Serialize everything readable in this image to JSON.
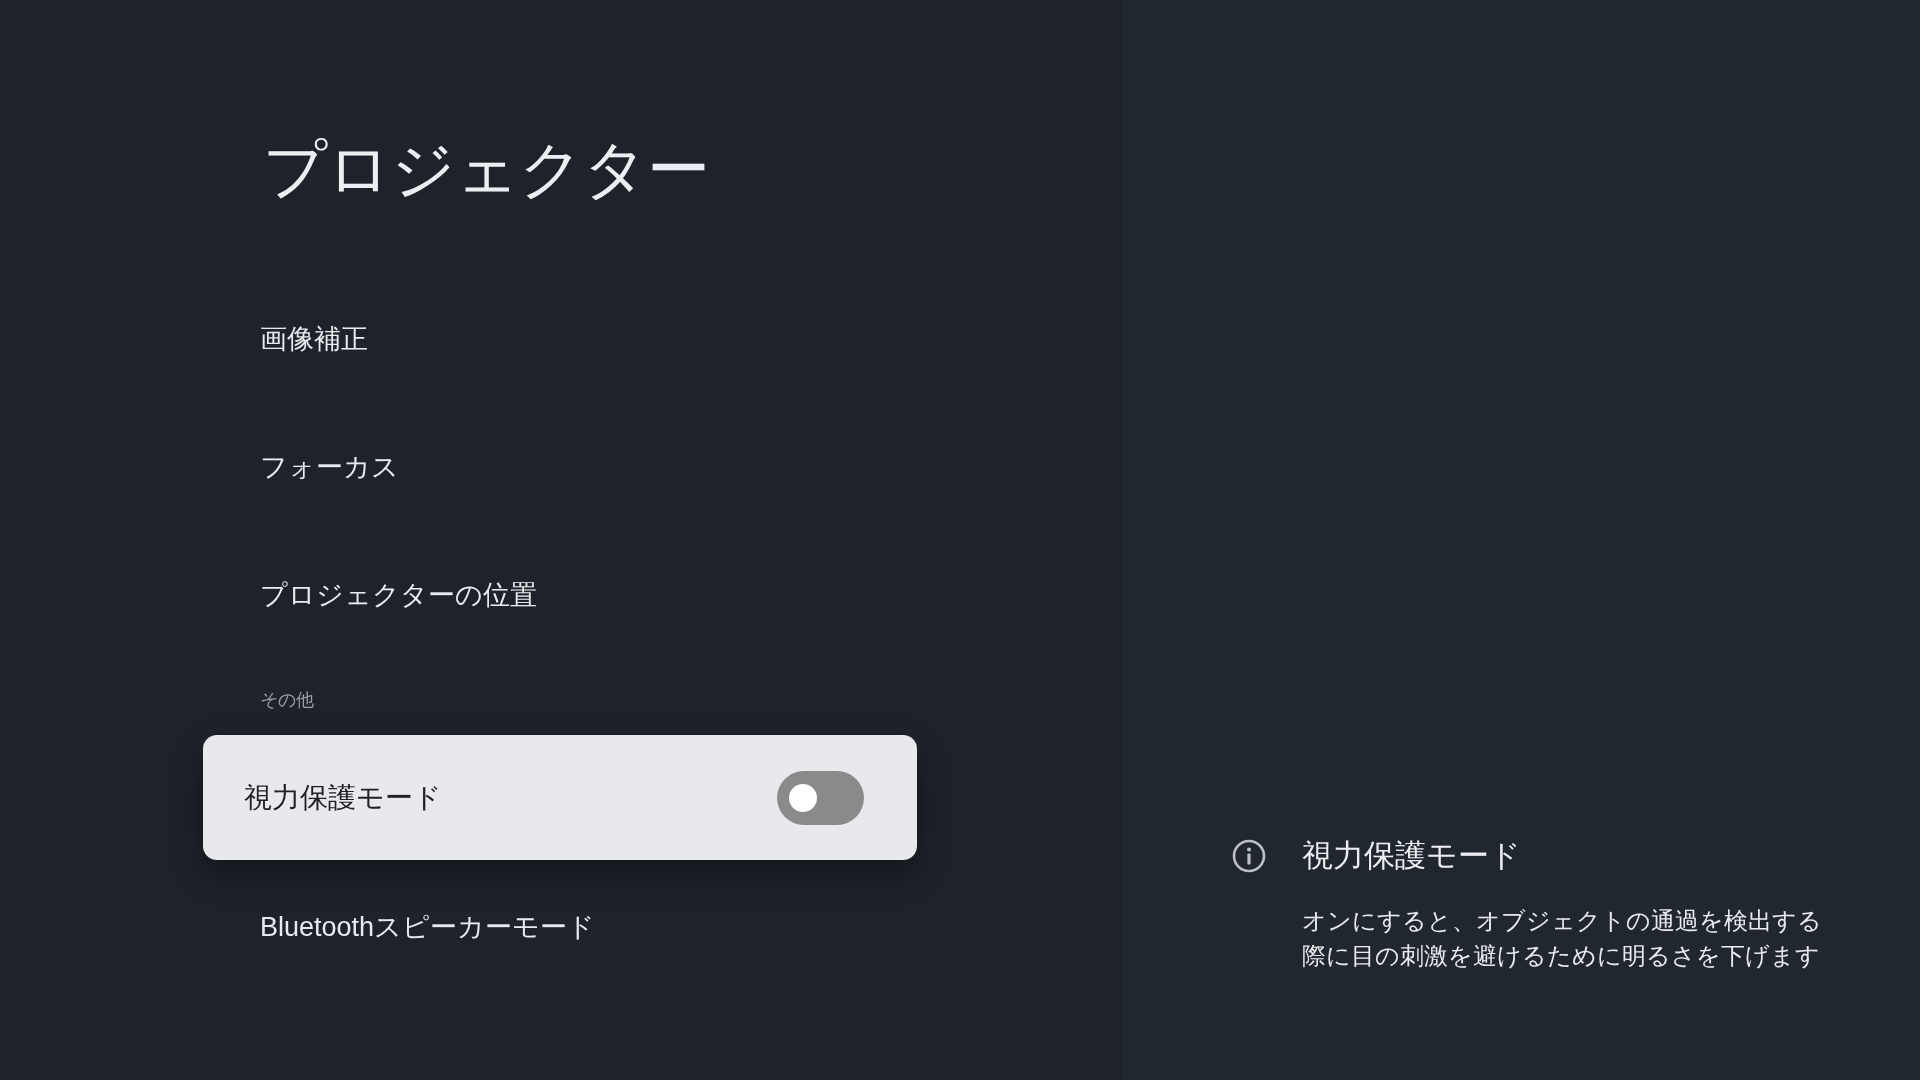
{
  "page": {
    "title": "プロジェクター"
  },
  "sections": [
    {
      "items": [
        {
          "kind": "item",
          "label": "画像補正",
          "selected": false
        },
        {
          "kind": "item",
          "label": "フォーカス",
          "selected": false
        },
        {
          "kind": "item",
          "label": "プロジェクターの位置",
          "selected": false
        }
      ]
    },
    {
      "header": "その他",
      "items": [
        {
          "kind": "toggle",
          "label": "視力保護モード",
          "selected": true,
          "on": false
        },
        {
          "kind": "item",
          "label": "Bluetoothスピーカーモード",
          "selected": false
        }
      ]
    }
  ],
  "info_panel": {
    "title": "視力保護モード",
    "description": "オンにすると、オブジェクトの通過を検出する際に目の刺激を避けるために明るさを下げます"
  }
}
